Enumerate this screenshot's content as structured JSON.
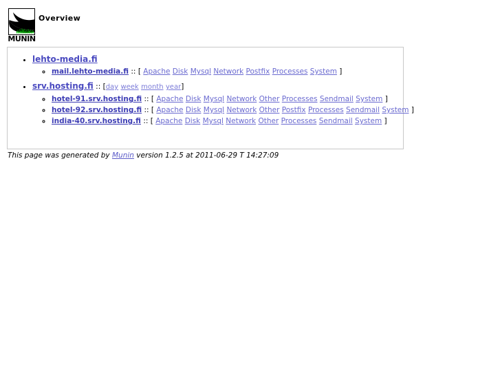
{
  "header": {
    "title": "Overview",
    "logo_alt": "MUNIN",
    "logo_word": "MUNIN"
  },
  "separator": "::",
  "bracket_open": "[",
  "bracket_close": "]",
  "colors": {
    "link": "#5b5bc8",
    "group_link": "#4a4ac0",
    "host_link": "#3c3cb4",
    "service_link": "#6a6ad0",
    "period_link": "#7a7ad8",
    "box_border": "#c8c8c8",
    "text": "#000000",
    "logo_bird": "#000000",
    "logo_grass": "#00c000"
  },
  "groups": [
    {
      "name": "lehto-media.fi",
      "periods": [],
      "hosts": [
        {
          "name": "mail.lehto-media.fi",
          "services": [
            "Apache",
            "Disk",
            "Mysql",
            "Network",
            "Postfix",
            "Processes",
            "System"
          ]
        }
      ]
    },
    {
      "name": "srv.hosting.fi",
      "periods": [
        "day",
        "week",
        "month",
        "year"
      ],
      "hosts": [
        {
          "name": "hotel-91.srv.hosting.fi",
          "services": [
            "Apache",
            "Disk",
            "Mysql",
            "Network",
            "Other",
            "Processes",
            "Sendmail",
            "System"
          ]
        },
        {
          "name": "hotel-92.srv.hosting.fi",
          "services": [
            "Apache",
            "Disk",
            "Mysql",
            "Network",
            "Other",
            "Postfix",
            "Processes",
            "Sendmail",
            "System"
          ]
        },
        {
          "name": "india-40.srv.hosting.fi",
          "services": [
            "Apache",
            "Disk",
            "Mysql",
            "Network",
            "Other",
            "Processes",
            "Sendmail",
            "System"
          ]
        }
      ]
    }
  ],
  "footer": {
    "prefix": "This page was generated by ",
    "link_label": "Munin",
    "suffix": " version 1.2.5 at 2011-06-29 T 14:27:09"
  }
}
